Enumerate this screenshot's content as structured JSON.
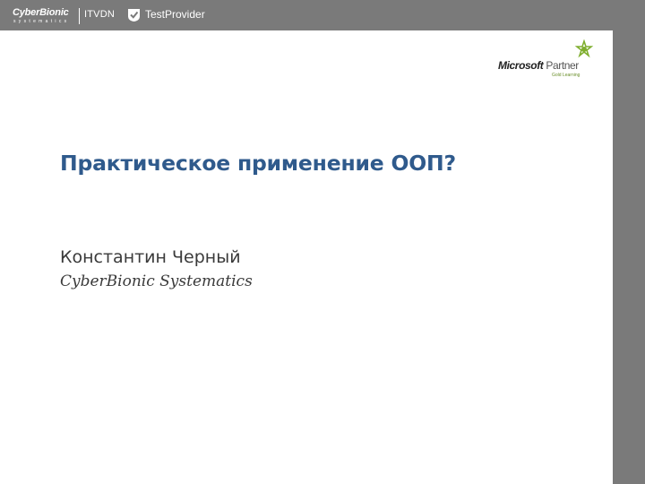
{
  "header": {
    "brand_cyberbionic": "CyberBionic",
    "brand_cyberbionic_sub": "systematics",
    "brand_itvdn": "ITVDN",
    "brand_testprovider": "TestProvider",
    "testprovider_icon": "shield-check-icon"
  },
  "partner_logo": {
    "company": "Microsoft",
    "label": "Partner",
    "sublabel": "Gold Learning",
    "icon": "gold-partner-icon"
  },
  "slide": {
    "title": "Практическое применение ООП?",
    "author": "Константин Черный",
    "company": "CyberBionic Systematics"
  },
  "colors": {
    "header_bg": "#7a7a7a",
    "title": "#2f5a8c",
    "text": "#3a3a3a"
  }
}
